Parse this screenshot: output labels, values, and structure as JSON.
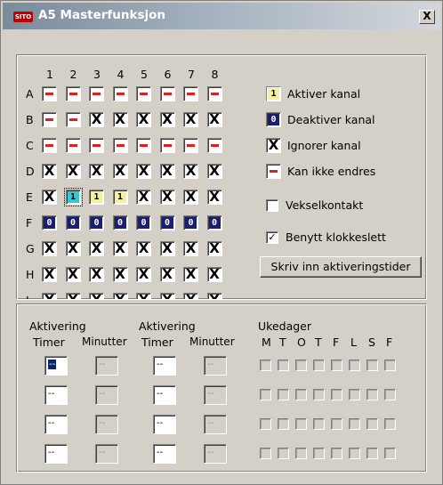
{
  "window": {
    "title": "A5  Masterfunksjon",
    "icon_text": "SITO",
    "close_label": "X"
  },
  "grid": {
    "columns": [
      "1",
      "2",
      "3",
      "4",
      "5",
      "6",
      "7",
      "8"
    ],
    "rows": [
      {
        "label": "A",
        "cells": [
          "-",
          "-",
          "-",
          "-",
          "-",
          "-",
          "-",
          "-"
        ]
      },
      {
        "label": "B",
        "cells": [
          "-",
          "-",
          "X",
          "X",
          "X",
          "X",
          "X",
          "X"
        ]
      },
      {
        "label": "C",
        "cells": [
          "-",
          "-",
          "-",
          "-",
          "-",
          "-",
          "-",
          "-"
        ]
      },
      {
        "label": "D",
        "cells": [
          "X",
          "X",
          "X",
          "X",
          "X",
          "X",
          "X",
          "X"
        ]
      },
      {
        "label": "E",
        "cells": [
          "X",
          "1",
          "1",
          "1",
          "X",
          "X",
          "X",
          "X"
        ]
      },
      {
        "label": "F",
        "cells": [
          "0",
          "0",
          "0",
          "0",
          "0",
          "0",
          "0",
          "0"
        ]
      },
      {
        "label": "G",
        "cells": [
          "X",
          "X",
          "X",
          "X",
          "X",
          "X",
          "X",
          "X"
        ]
      },
      {
        "label": "H",
        "cells": [
          "X",
          "X",
          "X",
          "X",
          "X",
          "X",
          "X",
          "X"
        ]
      },
      {
        "label": "I",
        "cells": [
          "X",
          "X",
          "X",
          "X",
          "X",
          "X",
          "X",
          "X"
        ]
      }
    ],
    "selected_cell": "E2"
  },
  "legend": {
    "activate": {
      "symbol": "1",
      "label": "Aktiver kanal"
    },
    "deactivate": {
      "symbol": "0",
      "label": "Deaktiver kanal"
    },
    "ignore": {
      "symbol": "X",
      "label": "Ignorer kanal"
    },
    "locked": {
      "symbol": "-",
      "label": "Kan ikke endres"
    }
  },
  "options": {
    "vekselkontakt": {
      "label": "Vekselkontakt",
      "checked": false
    },
    "klokkeslett": {
      "label": "Benytt klokkeslett",
      "checked": true,
      "mark": "✓"
    }
  },
  "activation_button_label": "Skriv inn aktiveringstider",
  "schedule": {
    "group1_label": "Aktivering",
    "group2_label": "Aktivering",
    "timer_label": "Timer",
    "minutter_label": "Minutter",
    "days_label": "Ukedager",
    "days": [
      "M",
      "T",
      "O",
      "T",
      "F",
      "L",
      "S",
      "F"
    ],
    "rows": [
      {
        "timer1": "--",
        "min1": "--",
        "timer2": "--",
        "min2": "--"
      },
      {
        "timer1": "--",
        "min1": "--",
        "timer2": "--",
        "min2": "--"
      },
      {
        "timer1": "--",
        "min1": "--",
        "timer2": "--",
        "min2": "--"
      },
      {
        "timer1": "--",
        "min1": "--",
        "timer2": "--",
        "min2": "--"
      }
    ]
  },
  "colors": {
    "dash_red": "#e02020",
    "zero_navy": "#1a1e6e",
    "one_yellow": "#f5f0a0",
    "one_teal": "#37c7d6"
  }
}
